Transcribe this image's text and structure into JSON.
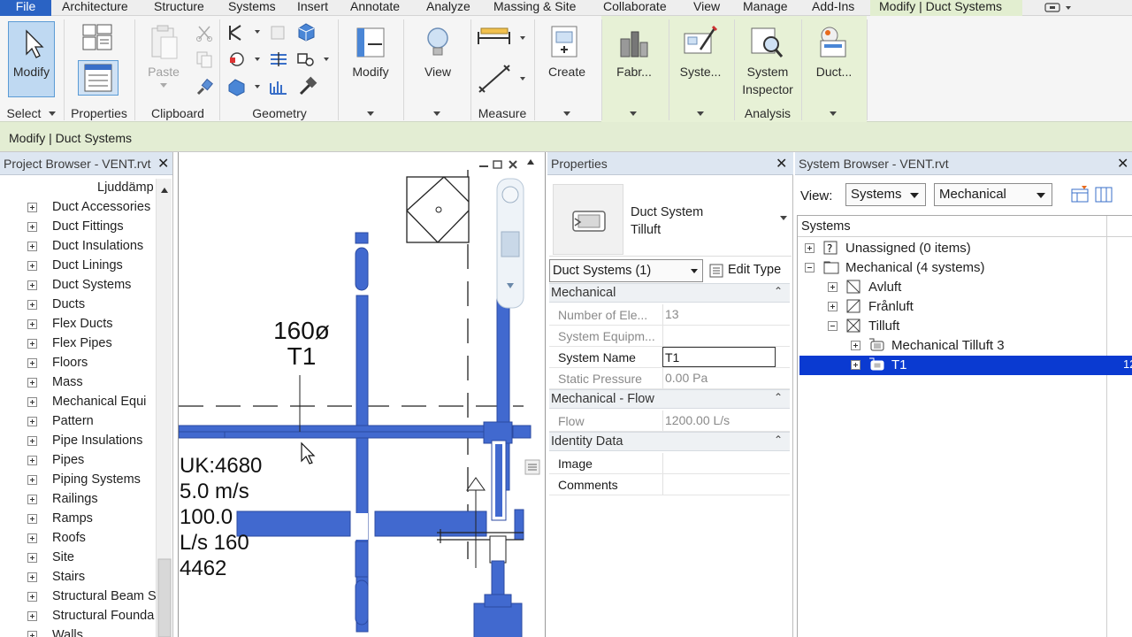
{
  "ribbon_tabs": [
    "File",
    "Architecture",
    "Structure",
    "Systems",
    "Insert",
    "Annotate",
    "Analyze",
    "Massing & Site",
    "Collaborate",
    "View",
    "Manage",
    "Add-Ins",
    "Modify | Duct Systems"
  ],
  "ribbon": {
    "modify_label": "Modify",
    "select_label": "Select",
    "properties_label": "Properties",
    "paste_label": "Paste",
    "clipboard_label": "Clipboard",
    "geometry_label": "Geometry",
    "modify2_label": "Modify",
    "view_label": "View",
    "measure_label": "Measure",
    "create_label": "Create",
    "fabr_label": "Fabr...",
    "syste_label": "Syste...",
    "system_inspector_line1": "System",
    "system_inspector_line2": "Inspector",
    "analysis_label": "Analysis",
    "duct_label": "Duct..."
  },
  "context_title": "Modify | Duct Systems",
  "project_browser": {
    "title": "Project Browser - VENT.rvt",
    "top_item": "Ljuddämp",
    "items": [
      "Duct Accessories",
      "Duct Fittings",
      "Duct Insulations",
      "Duct Linings",
      "Duct Systems",
      "Ducts",
      "Flex Ducts",
      "Flex Pipes",
      "Floors",
      "Mass",
      "Mechanical Equi",
      "Pattern",
      "Pipe Insulations",
      "Pipes",
      "Piping Systems",
      "Railings",
      "Ramps",
      "Roofs",
      "Site",
      "Stairs",
      "Structural Beam S",
      "Structural Founda",
      "Walls"
    ]
  },
  "canvas": {
    "tag1_line1": "160ø",
    "tag1_line2": "T1",
    "tag2_lines": [
      "UK:4680",
      "5.0 m/s",
      "100.0",
      "L/s 160",
      "4462"
    ]
  },
  "properties": {
    "title": "Properties",
    "type_line1": "Duct System",
    "type_line2": "Tilluft",
    "selector": "Duct Systems (1)",
    "edit_type": "Edit Type",
    "categories": [
      {
        "name": "Mechanical",
        "rows": [
          {
            "key": "Number of Ele...",
            "value": "13",
            "grey": true
          },
          {
            "key": "System Equipm...",
            "value": "",
            "grey": true
          },
          {
            "key": "System Name",
            "value": "T1",
            "grey": false
          },
          {
            "key": "Static Pressure",
            "value": "0.00 Pa",
            "grey": true
          }
        ]
      },
      {
        "name": "Mechanical - Flow",
        "rows": [
          {
            "key": "Flow",
            "value": "1200.00 L/s",
            "grey": true
          }
        ]
      },
      {
        "name": "Identity Data",
        "rows": [
          {
            "key": "Image",
            "value": "",
            "grey": false
          },
          {
            "key": "Comments",
            "value": "",
            "grey": false
          }
        ]
      }
    ]
  },
  "system_browser": {
    "title": "System Browser - VENT.rvt",
    "view_label": "View:",
    "view_value": "Systems",
    "discipline_value": "Mechanical",
    "column_header": "Systems",
    "rows": [
      {
        "label": "Unassigned (0 items)",
        "level": 0,
        "toggle": "plus",
        "icon": "unassigned-icon"
      },
      {
        "label": "Mechanical (4 systems)",
        "level": 0,
        "toggle": "minus",
        "icon": "folder-icon"
      },
      {
        "label": "Avluft",
        "level": 1,
        "toggle": "plus",
        "icon": "exhaust-system-icon"
      },
      {
        "label": "Frånluft",
        "level": 1,
        "toggle": "plus",
        "icon": "return-system-icon"
      },
      {
        "label": "Tilluft",
        "level": 1,
        "toggle": "minus",
        "icon": "supply-system-icon"
      },
      {
        "label": "Mechanical Tilluft 3",
        "level": 2,
        "toggle": "plus",
        "icon": "duct-system-icon"
      },
      {
        "label": "T1",
        "level": 2,
        "toggle": "plus",
        "icon": "duct-system-icon",
        "selected": true
      }
    ],
    "selected_extra": "12"
  },
  "colors": {
    "accent": "#2a63c4",
    "contextual_tab": "#e2eed0",
    "duct_blue": "#4169cf",
    "selection": "#0a3ad1"
  }
}
